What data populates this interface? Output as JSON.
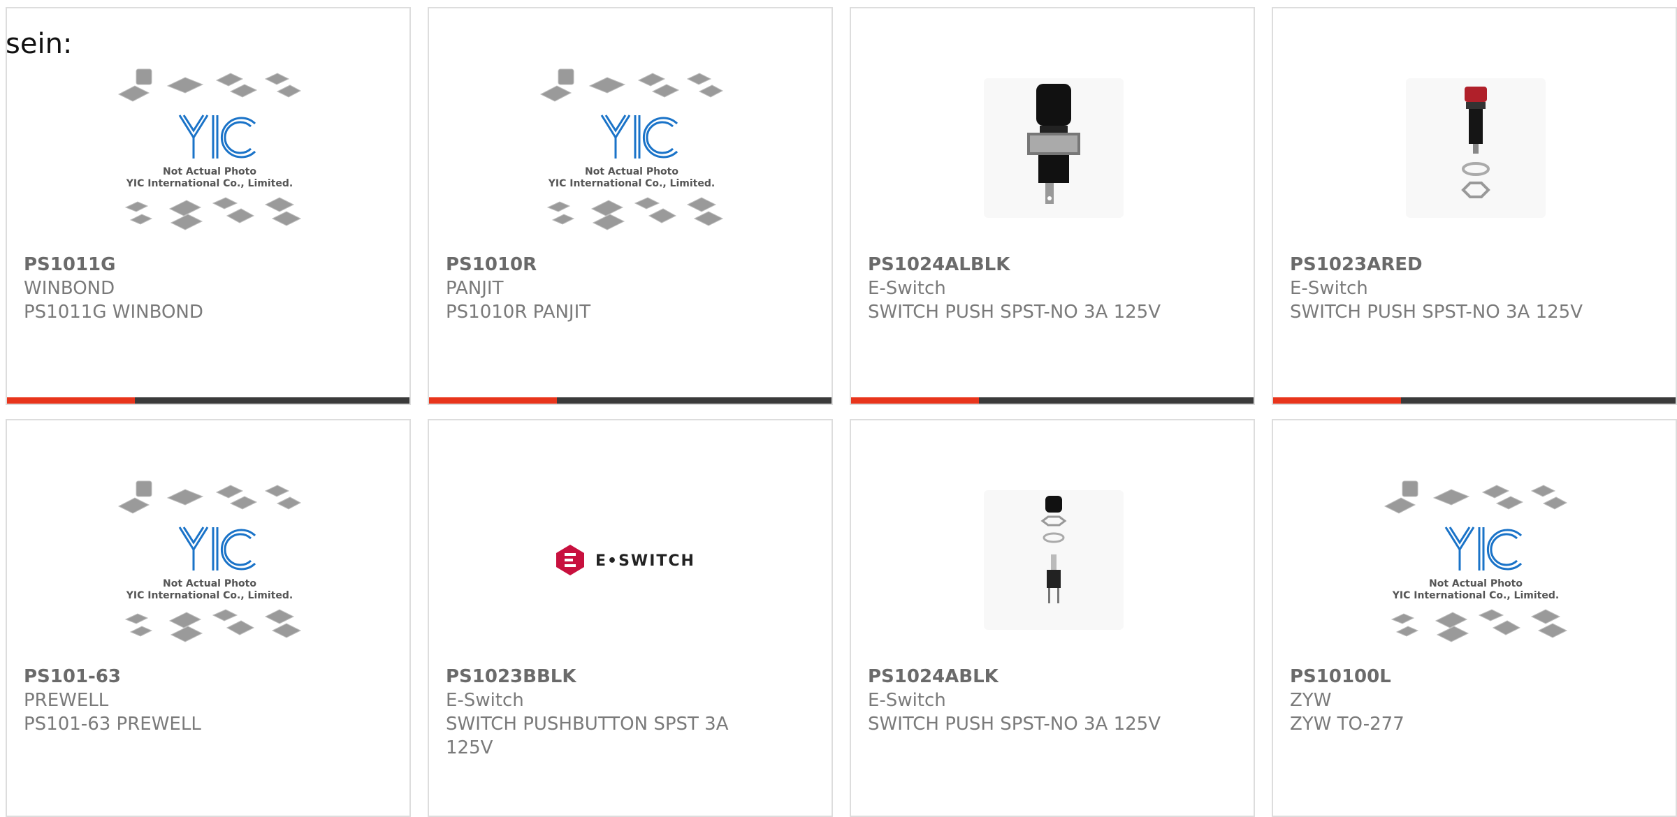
{
  "stray_text": "sein:",
  "products": [
    {
      "part": "PS1011G",
      "manufacturer": "WINBOND",
      "description": "PS1011G WINBOND",
      "image": "yic-placeholder",
      "image_caption": [
        "Not Actual Photo",
        "YIC International Co., Limited."
      ],
      "logo_text": "YIC"
    },
    {
      "part": "PS1010R",
      "manufacturer": "PANJIT",
      "description": "PS1010R PANJIT",
      "image": "yic-placeholder",
      "image_caption": [
        "Not Actual Photo",
        "YIC International Co., Limited."
      ],
      "logo_text": "YIC"
    },
    {
      "part": "PS1024ALBLK",
      "manufacturer": "E-Switch",
      "description": "SWITCH PUSH SPST-NO 3A 125V",
      "image": "black-pushbutton-photo"
    },
    {
      "part": "PS1023ARED",
      "manufacturer": "E-Switch",
      "description": "SWITCH PUSH SPST-NO 3A 125V",
      "image": "red-pushbutton-photo"
    },
    {
      "part": "PS101-63",
      "manufacturer": "PREWELL",
      "description": "PS101-63 PREWELL",
      "image": "yic-placeholder",
      "image_caption": [
        "Not Actual Photo",
        "YIC International Co., Limited."
      ],
      "logo_text": "YIC"
    },
    {
      "part": "PS1023BBLK",
      "manufacturer": "E-Switch",
      "description": "SWITCH PUSHBUTTON SPST 3A 125V",
      "image": "e-switch-logo",
      "logo_text": "E•SWITCH"
    },
    {
      "part": "PS1024ABLK",
      "manufacturer": "E-Switch",
      "description": "SWITCH PUSH SPST-NO 3A 125V",
      "image": "exploded-pushbutton-photo"
    },
    {
      "part": "PS10100L",
      "manufacturer": "ZYW",
      "description": "ZYW TO-277",
      "image": "yic-placeholder",
      "image_caption": [
        "Not Actual Photo",
        "YIC International Co., Limited."
      ],
      "logo_text": "YIC"
    }
  ],
  "colors": {
    "accent": "#e8351c",
    "bar_dark": "#3a3a3a",
    "yic_blue": "#1a73c8",
    "eswitch_magenta": "#c8103e"
  }
}
